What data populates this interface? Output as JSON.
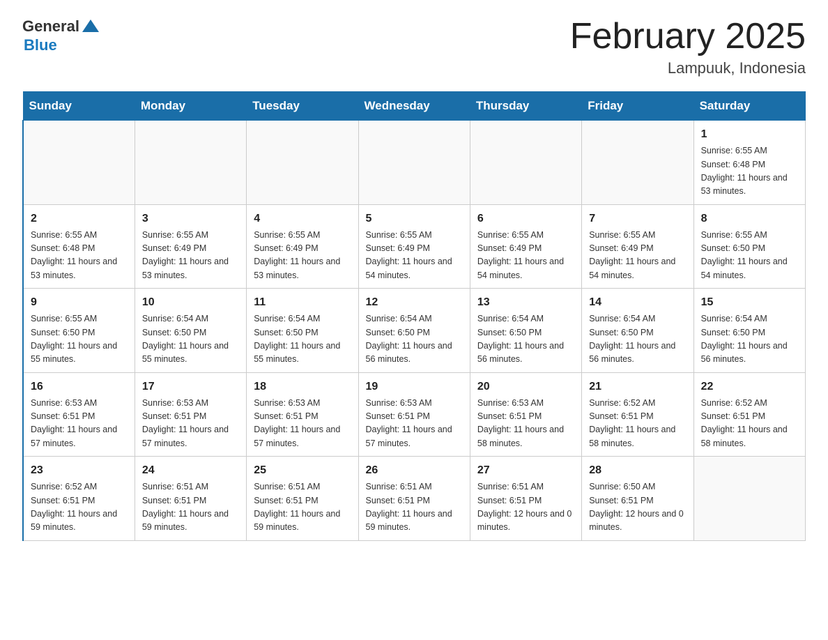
{
  "header": {
    "logo_general": "General",
    "logo_blue": "Blue",
    "month_title": "February 2025",
    "location": "Lampuuk, Indonesia"
  },
  "weekdays": [
    "Sunday",
    "Monday",
    "Tuesday",
    "Wednesday",
    "Thursday",
    "Friday",
    "Saturday"
  ],
  "weeks": [
    [
      {
        "day": "",
        "sunrise": "",
        "sunset": "",
        "daylight": ""
      },
      {
        "day": "",
        "sunrise": "",
        "sunset": "",
        "daylight": ""
      },
      {
        "day": "",
        "sunrise": "",
        "sunset": "",
        "daylight": ""
      },
      {
        "day": "",
        "sunrise": "",
        "sunset": "",
        "daylight": ""
      },
      {
        "day": "",
        "sunrise": "",
        "sunset": "",
        "daylight": ""
      },
      {
        "day": "",
        "sunrise": "",
        "sunset": "",
        "daylight": ""
      },
      {
        "day": "1",
        "sunrise": "Sunrise: 6:55 AM",
        "sunset": "Sunset: 6:48 PM",
        "daylight": "Daylight: 11 hours and 53 minutes."
      }
    ],
    [
      {
        "day": "2",
        "sunrise": "Sunrise: 6:55 AM",
        "sunset": "Sunset: 6:48 PM",
        "daylight": "Daylight: 11 hours and 53 minutes."
      },
      {
        "day": "3",
        "sunrise": "Sunrise: 6:55 AM",
        "sunset": "Sunset: 6:49 PM",
        "daylight": "Daylight: 11 hours and 53 minutes."
      },
      {
        "day": "4",
        "sunrise": "Sunrise: 6:55 AM",
        "sunset": "Sunset: 6:49 PM",
        "daylight": "Daylight: 11 hours and 53 minutes."
      },
      {
        "day": "5",
        "sunrise": "Sunrise: 6:55 AM",
        "sunset": "Sunset: 6:49 PM",
        "daylight": "Daylight: 11 hours and 54 minutes."
      },
      {
        "day": "6",
        "sunrise": "Sunrise: 6:55 AM",
        "sunset": "Sunset: 6:49 PM",
        "daylight": "Daylight: 11 hours and 54 minutes."
      },
      {
        "day": "7",
        "sunrise": "Sunrise: 6:55 AM",
        "sunset": "Sunset: 6:49 PM",
        "daylight": "Daylight: 11 hours and 54 minutes."
      },
      {
        "day": "8",
        "sunrise": "Sunrise: 6:55 AM",
        "sunset": "Sunset: 6:50 PM",
        "daylight": "Daylight: 11 hours and 54 minutes."
      }
    ],
    [
      {
        "day": "9",
        "sunrise": "Sunrise: 6:55 AM",
        "sunset": "Sunset: 6:50 PM",
        "daylight": "Daylight: 11 hours and 55 minutes."
      },
      {
        "day": "10",
        "sunrise": "Sunrise: 6:54 AM",
        "sunset": "Sunset: 6:50 PM",
        "daylight": "Daylight: 11 hours and 55 minutes."
      },
      {
        "day": "11",
        "sunrise": "Sunrise: 6:54 AM",
        "sunset": "Sunset: 6:50 PM",
        "daylight": "Daylight: 11 hours and 55 minutes."
      },
      {
        "day": "12",
        "sunrise": "Sunrise: 6:54 AM",
        "sunset": "Sunset: 6:50 PM",
        "daylight": "Daylight: 11 hours and 56 minutes."
      },
      {
        "day": "13",
        "sunrise": "Sunrise: 6:54 AM",
        "sunset": "Sunset: 6:50 PM",
        "daylight": "Daylight: 11 hours and 56 minutes."
      },
      {
        "day": "14",
        "sunrise": "Sunrise: 6:54 AM",
        "sunset": "Sunset: 6:50 PM",
        "daylight": "Daylight: 11 hours and 56 minutes."
      },
      {
        "day": "15",
        "sunrise": "Sunrise: 6:54 AM",
        "sunset": "Sunset: 6:50 PM",
        "daylight": "Daylight: 11 hours and 56 minutes."
      }
    ],
    [
      {
        "day": "16",
        "sunrise": "Sunrise: 6:53 AM",
        "sunset": "Sunset: 6:51 PM",
        "daylight": "Daylight: 11 hours and 57 minutes."
      },
      {
        "day": "17",
        "sunrise": "Sunrise: 6:53 AM",
        "sunset": "Sunset: 6:51 PM",
        "daylight": "Daylight: 11 hours and 57 minutes."
      },
      {
        "day": "18",
        "sunrise": "Sunrise: 6:53 AM",
        "sunset": "Sunset: 6:51 PM",
        "daylight": "Daylight: 11 hours and 57 minutes."
      },
      {
        "day": "19",
        "sunrise": "Sunrise: 6:53 AM",
        "sunset": "Sunset: 6:51 PM",
        "daylight": "Daylight: 11 hours and 57 minutes."
      },
      {
        "day": "20",
        "sunrise": "Sunrise: 6:53 AM",
        "sunset": "Sunset: 6:51 PM",
        "daylight": "Daylight: 11 hours and 58 minutes."
      },
      {
        "day": "21",
        "sunrise": "Sunrise: 6:52 AM",
        "sunset": "Sunset: 6:51 PM",
        "daylight": "Daylight: 11 hours and 58 minutes."
      },
      {
        "day": "22",
        "sunrise": "Sunrise: 6:52 AM",
        "sunset": "Sunset: 6:51 PM",
        "daylight": "Daylight: 11 hours and 58 minutes."
      }
    ],
    [
      {
        "day": "23",
        "sunrise": "Sunrise: 6:52 AM",
        "sunset": "Sunset: 6:51 PM",
        "daylight": "Daylight: 11 hours and 59 minutes."
      },
      {
        "day": "24",
        "sunrise": "Sunrise: 6:51 AM",
        "sunset": "Sunset: 6:51 PM",
        "daylight": "Daylight: 11 hours and 59 minutes."
      },
      {
        "day": "25",
        "sunrise": "Sunrise: 6:51 AM",
        "sunset": "Sunset: 6:51 PM",
        "daylight": "Daylight: 11 hours and 59 minutes."
      },
      {
        "day": "26",
        "sunrise": "Sunrise: 6:51 AM",
        "sunset": "Sunset: 6:51 PM",
        "daylight": "Daylight: 11 hours and 59 minutes."
      },
      {
        "day": "27",
        "sunrise": "Sunrise: 6:51 AM",
        "sunset": "Sunset: 6:51 PM",
        "daylight": "Daylight: 12 hours and 0 minutes."
      },
      {
        "day": "28",
        "sunrise": "Sunrise: 6:50 AM",
        "sunset": "Sunset: 6:51 PM",
        "daylight": "Daylight: 12 hours and 0 minutes."
      },
      {
        "day": "",
        "sunrise": "",
        "sunset": "",
        "daylight": ""
      }
    ]
  ]
}
